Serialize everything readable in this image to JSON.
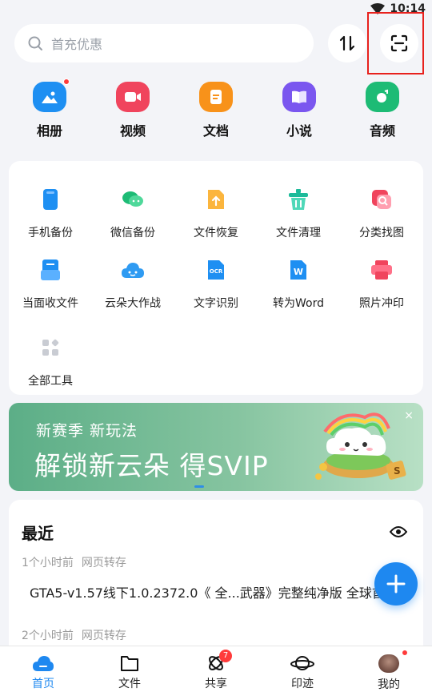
{
  "status": {
    "time": "10:14"
  },
  "search": {
    "placeholder": "首充优惠"
  },
  "categories": [
    {
      "label": "相册",
      "icon": "album-icon",
      "color": "#1e8ff2"
    },
    {
      "label": "视频",
      "icon": "video-icon",
      "color": "#f0445d"
    },
    {
      "label": "文档",
      "icon": "document-icon",
      "color": "#f8921a"
    },
    {
      "label": "小说",
      "icon": "novel-icon",
      "color": "#7a56ef"
    },
    {
      "label": "音频",
      "icon": "audio-icon",
      "color": "#1dbb75"
    }
  ],
  "tools": [
    {
      "label": "手机备份",
      "icon": "phone-backup-icon"
    },
    {
      "label": "微信备份",
      "icon": "wechat-backup-icon"
    },
    {
      "label": "文件恢复",
      "icon": "file-recovery-icon"
    },
    {
      "label": "文件清理",
      "icon": "file-cleanup-icon"
    },
    {
      "label": "分类找图",
      "icon": "image-search-icon"
    },
    {
      "label": "当面收文件",
      "icon": "receive-file-icon"
    },
    {
      "label": "云朵大作战",
      "icon": "cloud-game-icon"
    },
    {
      "label": "文字识别",
      "icon": "ocr-icon"
    },
    {
      "label": "转为Word",
      "icon": "to-word-icon"
    },
    {
      "label": "照片冲印",
      "icon": "photo-print-icon"
    },
    {
      "label": "全部工具",
      "icon": "all-tools-icon"
    }
  ],
  "banner": {
    "subtitle": "新赛季 新玩法",
    "title": "解锁新云朵 得SVIP",
    "close": "×"
  },
  "recent": {
    "title": "最近",
    "groups": [
      {
        "time": "1个小时前",
        "source": "网页转存",
        "file": "GTA5-v1.57线下1.0.2372.0《 全...武器》完整纯净版 全球首"
      },
      {
        "time": "2个小时前",
        "source": "网页转存"
      }
    ]
  },
  "nav": [
    {
      "label": "首页",
      "icon": "home-cloud-icon",
      "active": true
    },
    {
      "label": "文件",
      "icon": "folder-icon"
    },
    {
      "label": "共享",
      "icon": "share-orbit-icon",
      "badge": "7"
    },
    {
      "label": "印迹",
      "icon": "planet-icon"
    },
    {
      "label": "我的",
      "icon": "avatar-icon"
    }
  ],
  "colors": {
    "accent": "#1e88f0",
    "highlight": "#e8211d",
    "badge": "#ff3b3b"
  }
}
